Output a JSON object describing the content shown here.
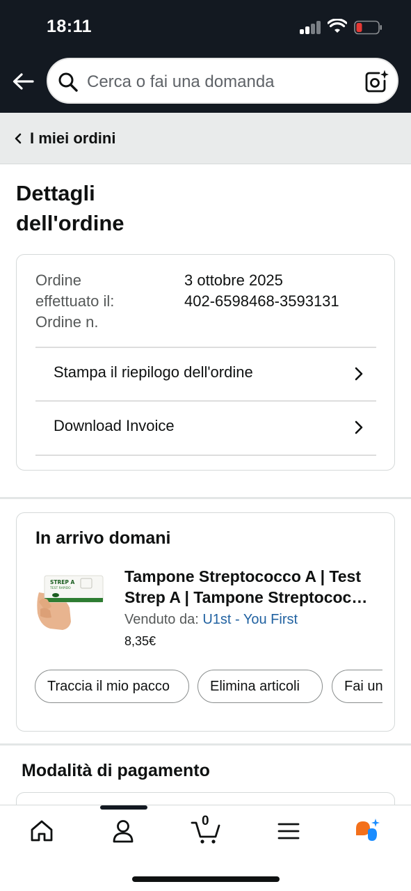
{
  "status_bar": {
    "time": "18:11",
    "battery_color": "#e53935"
  },
  "header": {
    "search_placeholder": "Cerca o fai una domanda",
    "background": "#131921"
  },
  "breadcrumb": {
    "label": "I miei ordini"
  },
  "page": {
    "title_line1": "Dettagli",
    "title_line2": "dell'ordine"
  },
  "order_summary": {
    "date_label_line1": "Ordine",
    "date_label_line2": "effettuato il:",
    "number_label": "Ordine n.",
    "date_value": "3 ottobre 2025",
    "number_value": "402-6598468-3593131",
    "actions": [
      {
        "label": "Stampa il riepilogo dell'ordine"
      },
      {
        "label": "Download Invoice"
      }
    ]
  },
  "shipment": {
    "status": "In arrivo domani",
    "product": {
      "title_line1": "Tampone Streptococco A | Test",
      "title_line2": "Strep A | Tampone Streptococco A",
      "seller_prefix": "Venduto da:",
      "seller_name": "U1st - You First",
      "price": "8,35€",
      "image_text_1": "STREP A",
      "image_text_2": "TEST RAPIDO"
    },
    "chips": [
      {
        "label": "Traccia il mio pacco"
      },
      {
        "label": "Elimina articoli"
      },
      {
        "label": "Fai una domanda"
      }
    ]
  },
  "payment": {
    "heading": "Modalità di pagamento"
  },
  "bottom_nav": {
    "items": [
      {
        "icon": "home-icon"
      },
      {
        "icon": "account-icon"
      },
      {
        "icon": "cart-icon"
      },
      {
        "icon": "menu-icon"
      },
      {
        "icon": "rufus-icon"
      }
    ],
    "cart_count": "0",
    "accent": "#f3701b",
    "ai_accent": "#1a8cff"
  }
}
